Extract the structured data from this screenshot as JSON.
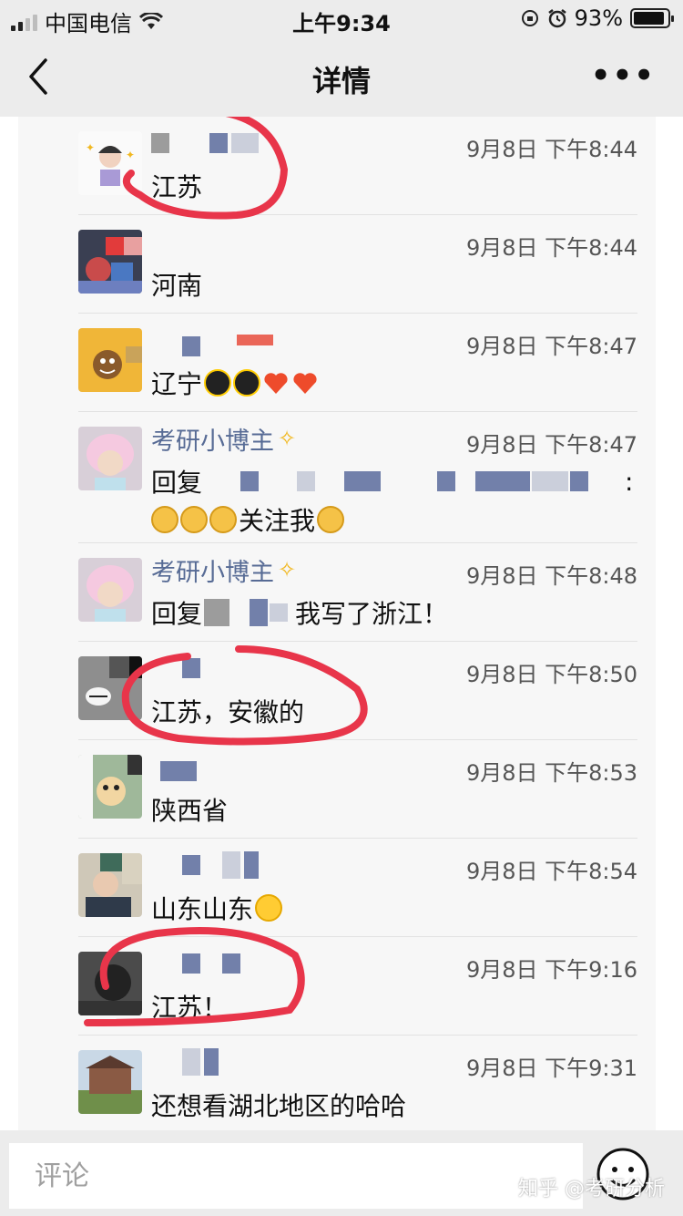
{
  "status_bar": {
    "carrier": "中国电信",
    "time": "上午9:34",
    "battery_percent": "93%",
    "battery_level": 0.93
  },
  "nav": {
    "title": "详情",
    "back_icon": "chevron-left-icon",
    "more_icon": "ellipsis-icon"
  },
  "comments": [
    {
      "time": "9月8日 下午8:44",
      "text": "江苏",
      "circled": true
    },
    {
      "time": "9月8日 下午8:44",
      "text": "河南"
    },
    {
      "time": "9月8日 下午8:47",
      "text": "辽宁"
    },
    {
      "name": "考研小博主",
      "time": "9月8日 下午8:47",
      "text": "回复",
      "text_line2": "关注我"
    },
    {
      "name": "考研小博主",
      "time": "9月8日 下午8:48",
      "text": "回复",
      "text_tail": "我写了浙江！"
    },
    {
      "time": "9月8日 下午8:50",
      "text": "江苏，安徽的",
      "circled": true
    },
    {
      "time": "9月8日 下午8:53",
      "text": "陕西省"
    },
    {
      "time": "9月8日 下午8:54",
      "text": "山东山东"
    },
    {
      "time": "9月8日 下午9:16",
      "text": "江苏！",
      "circled": true
    },
    {
      "time": "9月8日 下午9:31",
      "text": "还想看湖北地区的哈哈"
    }
  ],
  "comment_bar": {
    "placeholder": "评论",
    "emoji_icon": "smiley-icon",
    "watermark": "知乎 @考研分析"
  },
  "colors": {
    "nickname": "#576b95",
    "annotation": "#e8354a",
    "bar": "#ececec"
  }
}
